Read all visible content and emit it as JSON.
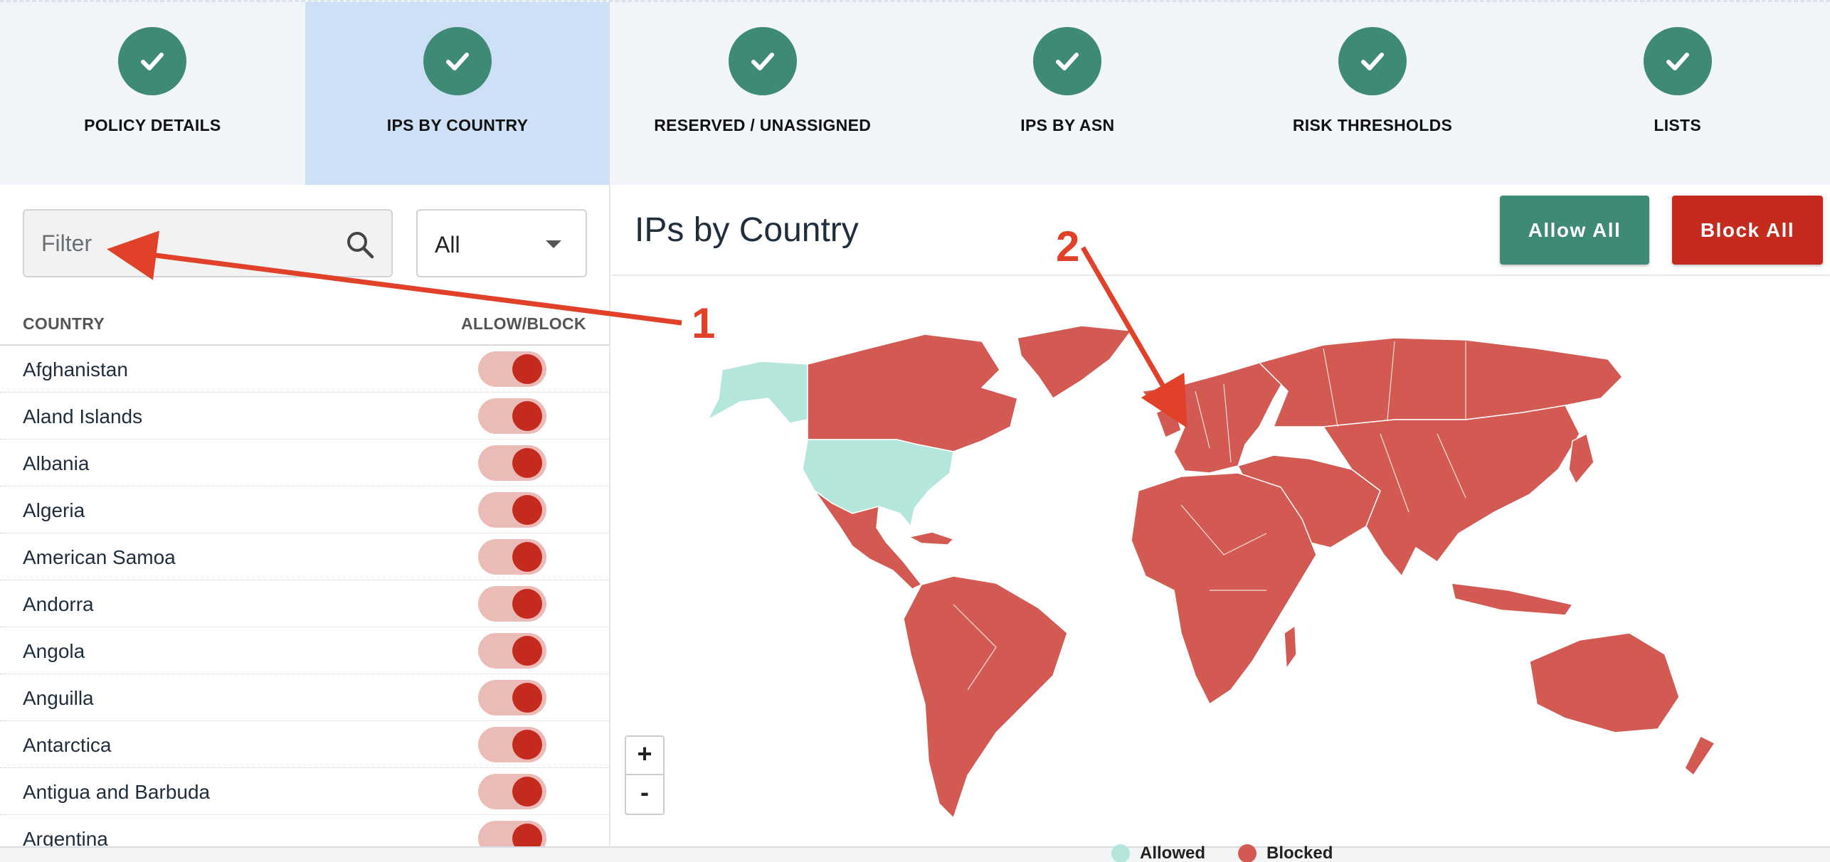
{
  "steps": [
    {
      "label": "POLICY DETAILS"
    },
    {
      "label": "IPS BY COUNTRY"
    },
    {
      "label": "RESERVED / UNASSIGNED"
    },
    {
      "label": "IPS BY ASN"
    },
    {
      "label": "RISK THRESHOLDS"
    },
    {
      "label": "LISTS"
    }
  ],
  "filter": {
    "placeholder": "Filter"
  },
  "dropdown": {
    "value": "All"
  },
  "table": {
    "col_country": "COUNTRY",
    "col_toggle": "ALLOW/BLOCK",
    "rows": [
      {
        "name": "Afghanistan",
        "state": "blocked"
      },
      {
        "name": "Aland Islands",
        "state": "blocked"
      },
      {
        "name": "Albania",
        "state": "blocked"
      },
      {
        "name": "Algeria",
        "state": "blocked"
      },
      {
        "name": "American Samoa",
        "state": "blocked"
      },
      {
        "name": "Andorra",
        "state": "blocked"
      },
      {
        "name": "Angola",
        "state": "blocked"
      },
      {
        "name": "Anguilla",
        "state": "blocked"
      },
      {
        "name": "Antarctica",
        "state": "blocked"
      },
      {
        "name": "Antigua and Barbuda",
        "state": "blocked"
      },
      {
        "name": "Argentina",
        "state": "blocked"
      }
    ]
  },
  "main": {
    "title": "IPs by Country",
    "allow_all": "Allow All",
    "block_all": "Block All"
  },
  "zoom": {
    "in": "+",
    "out": "-"
  },
  "legend": {
    "allowed": "Allowed",
    "blocked": "Blocked"
  },
  "annotations": {
    "one": "1",
    "two": "2"
  },
  "colors": {
    "accent_green": "#3e8a77",
    "blocked_red": "#c42a1e",
    "map_blocked": "#d35a52",
    "map_allowed": "#b4e6dc",
    "annotation": "#e04128",
    "active_step": "#cde0f5"
  },
  "icons": {
    "step": "check-icon",
    "filter": "search-icon",
    "dropdown": "chevron-down-icon"
  }
}
